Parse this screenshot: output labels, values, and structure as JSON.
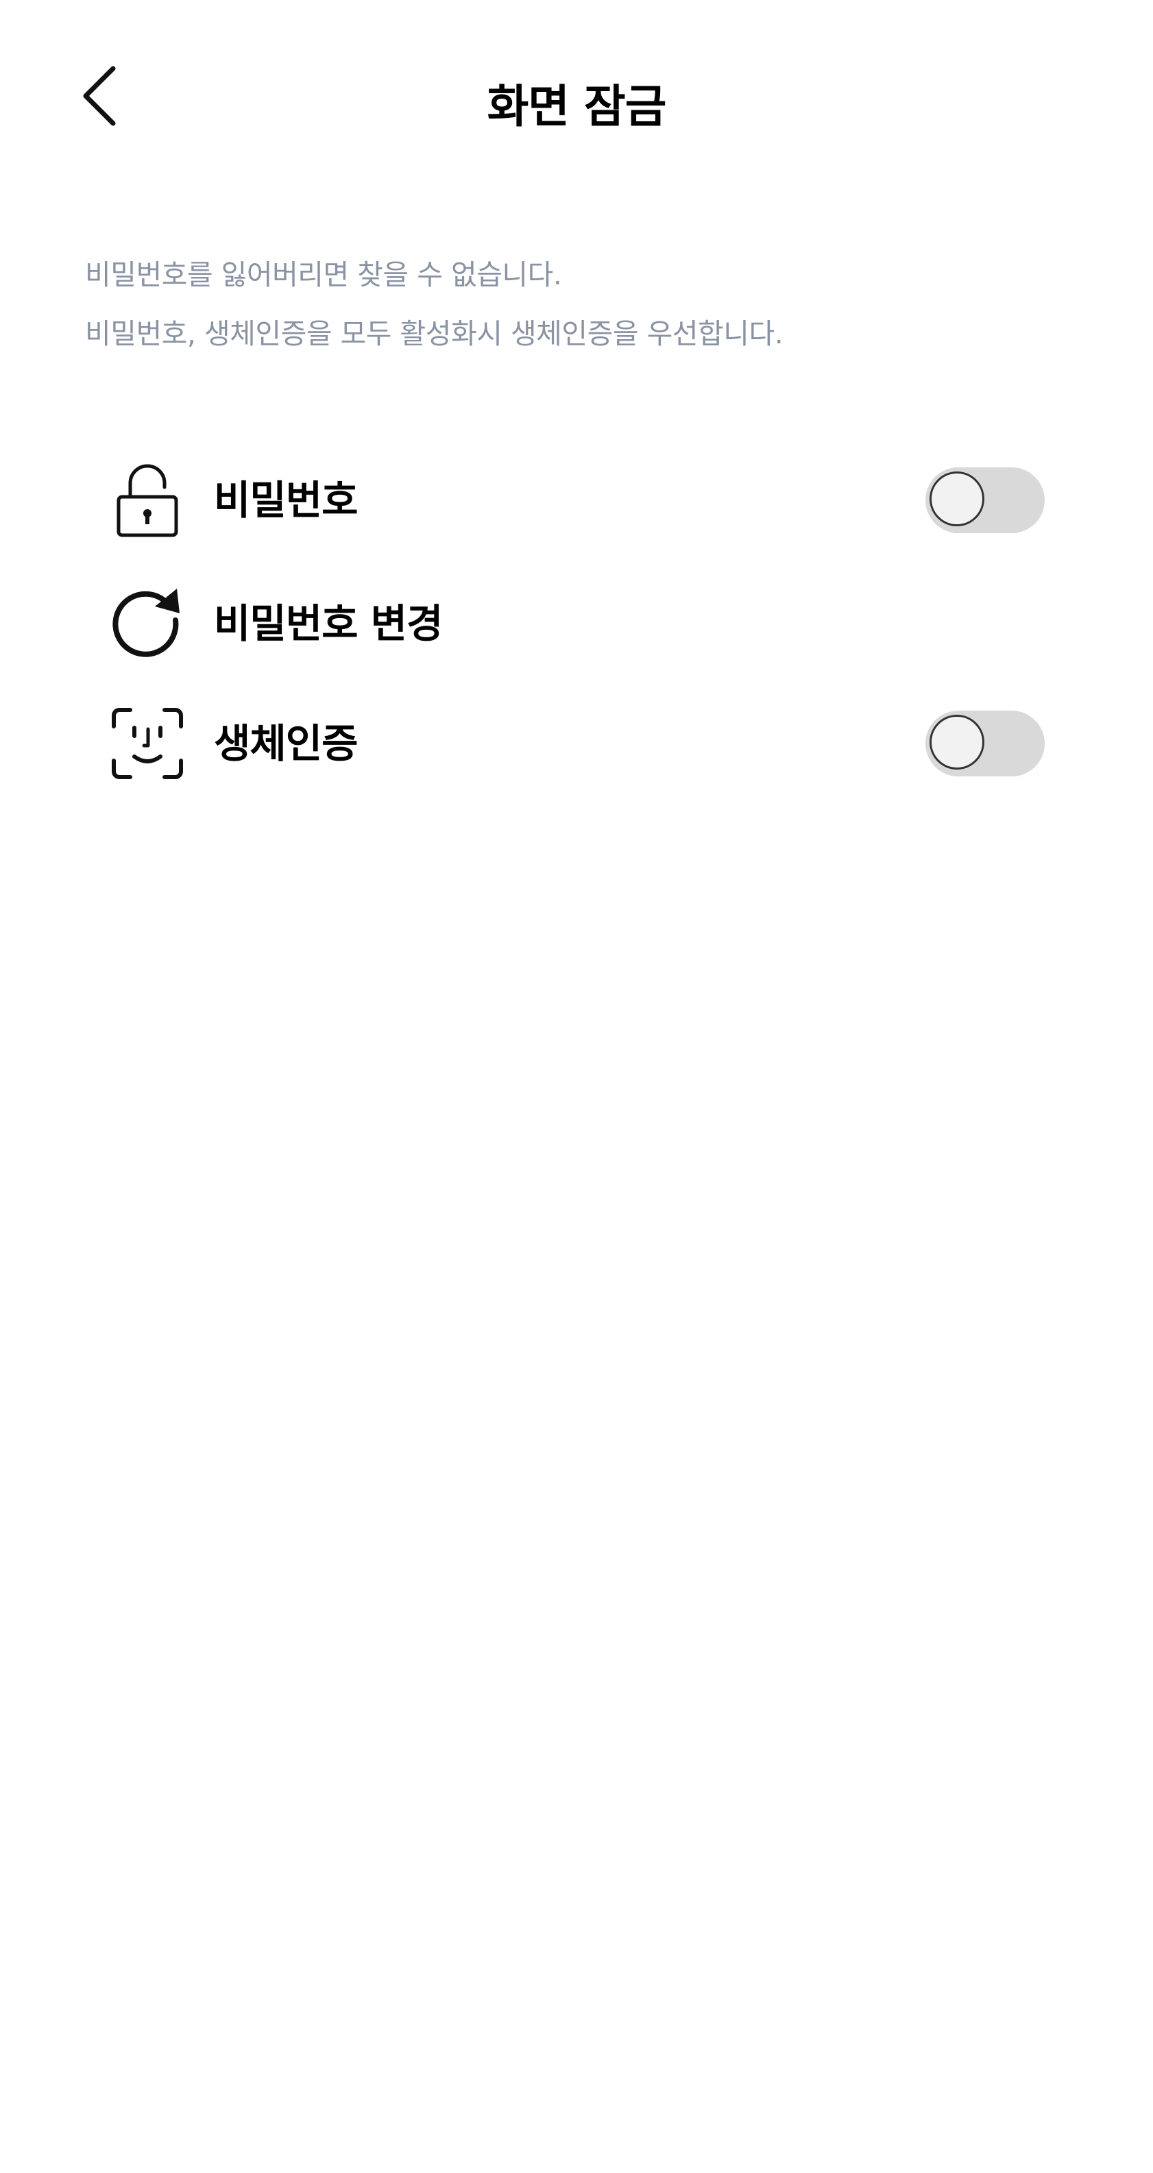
{
  "header": {
    "back_icon": "chevron-left-icon",
    "title": "화면 잠금"
  },
  "notice": {
    "line1": "비밀번호를 잃어버리면 찾을 수 없습니다.",
    "line2": "비밀번호, 생체인증을 모두 활성화시 생체인증을 우선합니다."
  },
  "settings": [
    {
      "label": "비밀번호",
      "icon": "lock-icon",
      "toggle": true,
      "enabled": false
    },
    {
      "label": "비밀번호 변경",
      "icon": "refresh-icon",
      "toggle": false
    },
    {
      "label": "생체인증",
      "icon": "face-id-icon",
      "toggle": true,
      "enabled": false
    }
  ],
  "colors": {
    "notice_text": "#8a93a3",
    "toggle_track_off": "#d9d9d9",
    "toggle_knob": "#f2f2f2",
    "text_primary": "#000000"
  }
}
